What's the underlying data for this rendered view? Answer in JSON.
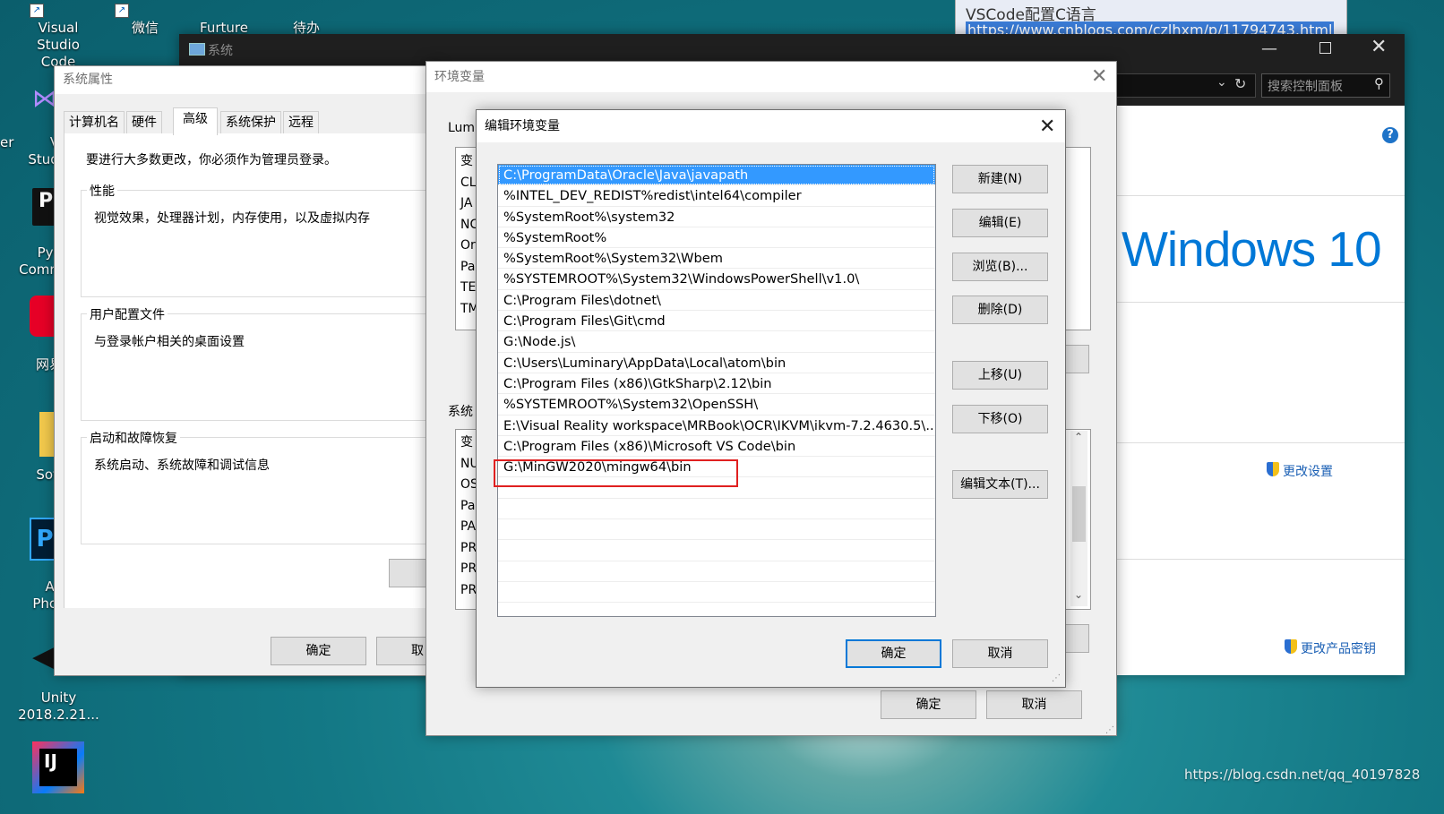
{
  "desktop": {
    "icons": [
      {
        "label1": "Visual",
        "label2": "Studio Code"
      },
      {
        "label1": "微信",
        "label2": ""
      },
      {
        "label1": "Furture",
        "label2": ""
      },
      {
        "label1": "待办",
        "label2": ""
      },
      {
        "label1": "Vi",
        "label2": "Studi"
      },
      {
        "label1": "PyC",
        "label2": "Comm"
      },
      {
        "label1": "网易",
        "label2": ""
      },
      {
        "label1": "Soft",
        "label2": ""
      },
      {
        "label1": "Ad",
        "label2": "Phot"
      },
      {
        "label1": "Unity",
        "label2": "2018.2.21..."
      },
      {
        "label1": "er",
        "label2": ""
      }
    ],
    "watermark": "https://blog.csdn.net/qq_40197828"
  },
  "browser_fragment": {
    "title": "VSCode配置C语言",
    "url": "https://www.cnblogs.com/czlhxm/p/11794743.html"
  },
  "control_panel": {
    "window_title": "系统",
    "search_placeholder": "搜索控制面板",
    "windows_logo": "Windows 10",
    "change_settings": "更改设置",
    "change_product_key": "更改产品密钥"
  },
  "system_properties": {
    "title": "系统属性",
    "tabs": [
      "计算机名",
      "硬件",
      "高级",
      "系统保护",
      "远程"
    ],
    "admin_note": "要进行大多数更改，你必须作为管理员登录。",
    "performance": {
      "legend": "性能",
      "desc": "视觉效果，处理器计划，内存使用，以及虚拟内存"
    },
    "user_profiles": {
      "legend": "用户配置文件",
      "desc": "与登录帐户相关的桌面设置"
    },
    "startup": {
      "legend": "启动和故障恢复",
      "desc": "系统启动、系统故障和调试信息"
    },
    "ok": "确定",
    "cancel": "取"
  },
  "env_vars": {
    "title": "环境变量",
    "user_section": "Lum",
    "system_section": "系统",
    "user_rows": [
      "变",
      "CL",
      "JA",
      "NC",
      "Or",
      "Pa",
      "TE",
      "TM"
    ],
    "system_rows": [
      "变",
      "NU",
      "OS",
      "Pa",
      "PA",
      "PR",
      "PR",
      "PR"
    ],
    "ok": "确定",
    "cancel": "取消"
  },
  "edit_env": {
    "title": "编辑环境变量",
    "entries": [
      "C:\\ProgramData\\Oracle\\Java\\javapath",
      "%INTEL_DEV_REDIST%redist\\intel64\\compiler",
      "%SystemRoot%\\system32",
      "%SystemRoot%",
      "%SystemRoot%\\System32\\Wbem",
      "%SYSTEMROOT%\\System32\\WindowsPowerShell\\v1.0\\",
      "C:\\Program Files\\dotnet\\",
      "C:\\Program Files\\Git\\cmd",
      "G:\\Node.js\\",
      "C:\\Users\\Luminary\\AppData\\Local\\atom\\bin",
      "C:\\Program Files (x86)\\GtkSharp\\2.12\\bin",
      "%SYSTEMROOT%\\System32\\OpenSSH\\",
      "E:\\Visual Reality workspace\\MRBook\\OCR\\IKVM\\ikvm-7.2.4630.5\\...",
      "C:\\Program Files (x86)\\Microsoft VS Code\\bin",
      "G:\\MinGW2020\\mingw64\\bin",
      "",
      "",
      "",
      "",
      "",
      "",
      ""
    ],
    "buttons": {
      "new": "新建(N)",
      "edit": "编辑(E)",
      "browse": "浏览(B)...",
      "delete": "删除(D)",
      "up": "上移(U)",
      "down": "下移(O)",
      "edit_text": "编辑文本(T)..."
    },
    "ok": "确定",
    "cancel": "取消",
    "highlight_color": "#e02020",
    "selection_color": "#3399ff"
  }
}
